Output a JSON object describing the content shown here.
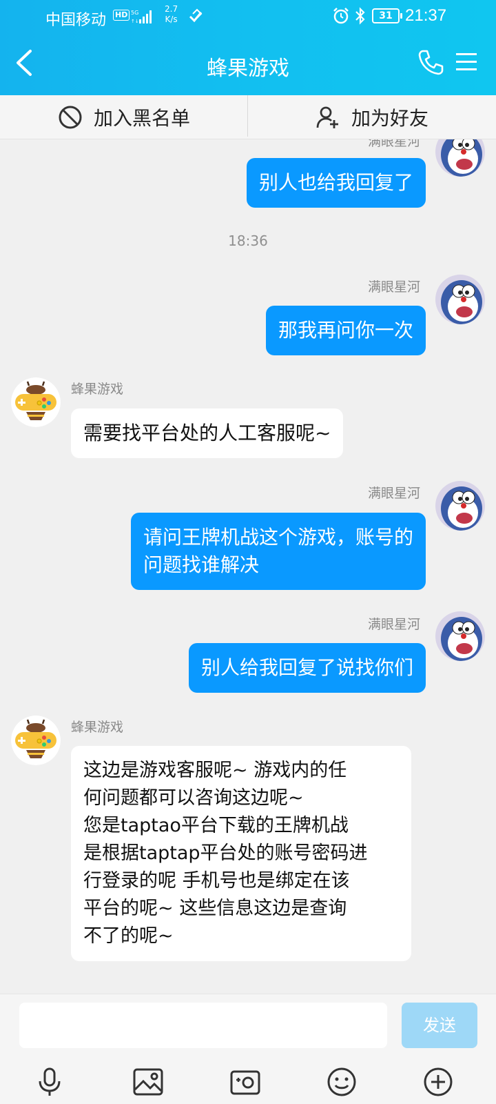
{
  "status": {
    "carrier": "中国移动",
    "hd": "HD",
    "speed_value": "2.7",
    "speed_unit": "K/s",
    "battery": "31",
    "time": "21:37"
  },
  "nav": {
    "title": "蜂果游戏"
  },
  "actions": {
    "blacklist": "加入黑名单",
    "add_friend": "加为好友"
  },
  "chat": {
    "partial_name": "满眼星河",
    "messages": [
      {
        "side": "me",
        "text": "别人也给我回复了"
      },
      {
        "timestamp": "18:36"
      },
      {
        "side": "me",
        "name": "满眼星河",
        "text": "那我再问你一次"
      },
      {
        "side": "them",
        "name": "蜂果游戏",
        "text": "需要找平台处的人工客服呢~"
      },
      {
        "side": "me",
        "name": "满眼星河",
        "lines": [
          "请问王牌机战这个游戏，账号的",
          "问题找谁解决"
        ]
      },
      {
        "side": "me",
        "name": "满眼星河",
        "text": "别人给我回复了说找你们"
      },
      {
        "side": "them",
        "name": "蜂果游戏",
        "lines": [
          "这边是游戏客服呢~  游戏内的任",
          "何问题都可以咨询这边呢~",
          "您是taptao平台下载的王牌机战",
          "是根据taptap平台处的账号密码进",
          "行登录的呢  手机号也是绑定在该",
          "平台的呢~   这些信息这边是查询",
          "不了的呢~"
        ]
      }
    ]
  },
  "input": {
    "placeholder": "",
    "send_label": "发送"
  },
  "toolbar": [
    "microphone-icon",
    "image-icon",
    "camera-icon",
    "emoji-icon",
    "plus-icon"
  ],
  "colors": {
    "header": "#14b3ee",
    "my_bubble": "#0a99ff",
    "their_bubble": "#ffffff",
    "send_disabled": "#9ed8f7"
  }
}
